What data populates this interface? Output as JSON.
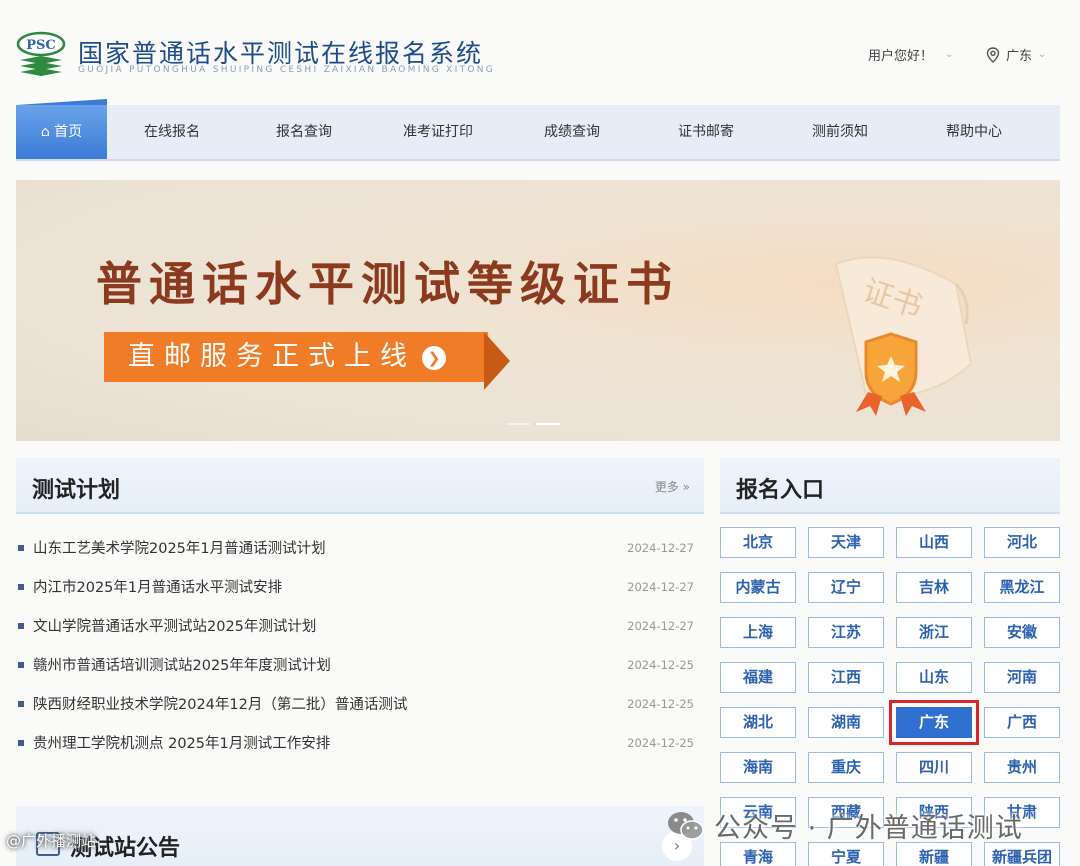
{
  "header": {
    "logo_text": "PSC",
    "title": "国家普通话水平测试在线报名系统",
    "subtitle": "GUOJIA PUTONGHUA SHUIPING CESHI ZAIXIAN BAOMING XITONG",
    "user_greeting": "用户您好！",
    "region": "广东"
  },
  "nav": {
    "items": [
      {
        "label": "首页"
      },
      {
        "label": "在线报名"
      },
      {
        "label": "报名查询"
      },
      {
        "label": "准考证打印"
      },
      {
        "label": "成绩查询"
      },
      {
        "label": "证书邮寄"
      },
      {
        "label": "测前须知"
      },
      {
        "label": "帮助中心"
      }
    ]
  },
  "banner": {
    "title": "普通话水平测试等级证书",
    "button": "直邮服务正式上线",
    "cert_text": "证书"
  },
  "plans": {
    "title": "测试计划",
    "more": "更多 »",
    "items": [
      {
        "title": "山东工艺美术学院2025年1月普通话测试计划",
        "date": "2024-12-27"
      },
      {
        "title": "内江市2025年1月普通话水平测试安排",
        "date": "2024-12-27"
      },
      {
        "title": "文山学院普通话水平测试站2025年测试计划",
        "date": "2024-12-27"
      },
      {
        "title": "赣州市普通话培训测试站2025年年度测试计划",
        "date": "2024-12-25"
      },
      {
        "title": "陕西财经职业技术学院2024年12月（第二批）普通话测试",
        "date": "2024-12-25"
      },
      {
        "title": "贵州理工学院机测点 2025年1月测试工作安排",
        "date": "2024-12-25"
      }
    ]
  },
  "notice": {
    "title": "测试站公告"
  },
  "entry": {
    "title": "报名入口",
    "provinces": [
      {
        "name": "北京"
      },
      {
        "name": "天津"
      },
      {
        "name": "山西"
      },
      {
        "name": "河北"
      },
      {
        "name": "内蒙古"
      },
      {
        "name": "辽宁"
      },
      {
        "name": "吉林"
      },
      {
        "name": "黑龙江"
      },
      {
        "name": "上海"
      },
      {
        "name": "江苏"
      },
      {
        "name": "浙江"
      },
      {
        "name": "安徽"
      },
      {
        "name": "福建"
      },
      {
        "name": "江西"
      },
      {
        "name": "山东"
      },
      {
        "name": "河南"
      },
      {
        "name": "湖北"
      },
      {
        "name": "湖南"
      },
      {
        "name": "广东"
      },
      {
        "name": "广西"
      },
      {
        "name": "海南"
      },
      {
        "name": "重庆"
      },
      {
        "name": "四川"
      },
      {
        "name": "贵州"
      },
      {
        "name": "云南"
      },
      {
        "name": "西藏"
      },
      {
        "name": "陕西"
      },
      {
        "name": "甘肃"
      },
      {
        "name": "青海"
      },
      {
        "name": "宁夏"
      },
      {
        "name": "新疆"
      },
      {
        "name": "新疆兵团"
      }
    ],
    "selected": "广东"
  },
  "watermark": {
    "text": "公众号 · 广外普通话测试",
    "small": "@广外播测站"
  },
  "colors": {
    "accent": "#3a7bd5",
    "banner_orange": "#f07c28",
    "highlight_red": "#d8262b"
  }
}
